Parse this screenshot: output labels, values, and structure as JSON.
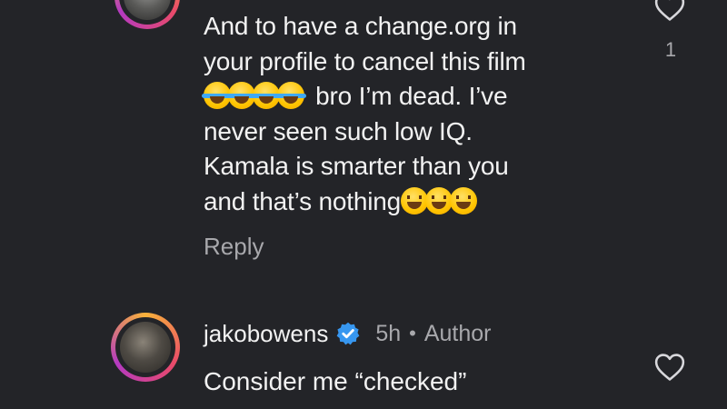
{
  "comment_top": {
    "lines": [
      "And to have a change.org in",
      "your profile to cancel this film",
      "bro I’m dead. I’ve",
      "never seen such low IQ.",
      "Kamala is smarter than you",
      "and that’s nothing"
    ],
    "emoji_line3": "face-with-tears-of-joy x4",
    "emoji_line6": "grinning-squinting-face x3",
    "reply_label": "Reply",
    "like_count": "1"
  },
  "comment_bottom": {
    "username": "jakobowens",
    "time": "5h",
    "separator": "•",
    "author_tag": "Author",
    "text": "Consider me “checked”"
  },
  "icons": {
    "like": "heart-outline-icon",
    "verified": "verified-badge-icon"
  },
  "colors": {
    "background": "#232428",
    "text": "#f2f2f2",
    "secondary_text": "#a8a8ac",
    "verified": "#3797f0"
  }
}
